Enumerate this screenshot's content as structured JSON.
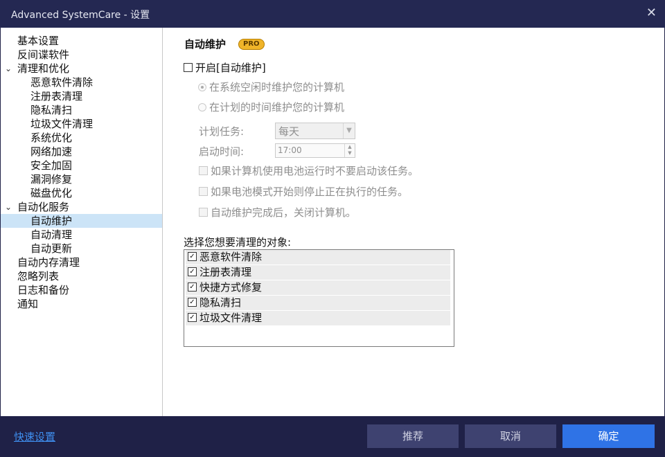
{
  "window": {
    "title": "Advanced SystemCare - 设置",
    "close_icon": "close-icon"
  },
  "sidebar": {
    "items": [
      {
        "label": "基本设置",
        "level": 0
      },
      {
        "label": "反间谍软件",
        "level": 0
      },
      {
        "label": "清理和优化",
        "level": 0,
        "expanded": true
      },
      {
        "label": "恶意软件清除",
        "level": 1
      },
      {
        "label": "注册表清理",
        "level": 1
      },
      {
        "label": "隐私清扫",
        "level": 1
      },
      {
        "label": "垃圾文件清理",
        "level": 1
      },
      {
        "label": "系统优化",
        "level": 1
      },
      {
        "label": "网络加速",
        "level": 1
      },
      {
        "label": "安全加固",
        "level": 1
      },
      {
        "label": "漏洞修复",
        "level": 1
      },
      {
        "label": "磁盘优化",
        "level": 1
      },
      {
        "label": "自动化服务",
        "level": 0,
        "expanded": true
      },
      {
        "label": "自动维护",
        "level": 1,
        "selected": true
      },
      {
        "label": "自动清理",
        "level": 1
      },
      {
        "label": "自动更新",
        "level": 1
      },
      {
        "label": "自动内存清理",
        "level": 0
      },
      {
        "label": "忽略列表",
        "level": 0
      },
      {
        "label": "日志和备份",
        "level": 0
      },
      {
        "label": "通知",
        "level": 0
      }
    ]
  },
  "main": {
    "section_title": "自动维护",
    "pro_badge": "PRO",
    "enable_label": "开启[自动维护]",
    "enable_checked": false,
    "radio_idle": "在系统空闲时维护您的计算机",
    "radio_schedule": "在计划的时间维护您的计算机",
    "schedule_label": "计划任务:",
    "schedule_value": "每天",
    "start_time_label": "启动时间:",
    "start_time_value": "17:00",
    "opt_battery": "如果计算机使用电池运行时不要启动该任务。",
    "opt_battery_stop": "如果电池模式开始则停止正在执行的任务。",
    "opt_shutdown": "自动维护完成后，关闭计算机。",
    "targets_label": "选择您想要清理的对象:",
    "targets": [
      {
        "label": "恶意软件清除",
        "checked": true
      },
      {
        "label": "注册表清理",
        "checked": true
      },
      {
        "label": "快捷方式修复",
        "checked": true
      },
      {
        "label": "隐私清扫",
        "checked": true
      },
      {
        "label": "垃圾文件清理",
        "checked": true
      }
    ]
  },
  "footer": {
    "quick_settings": "快速设置",
    "recommend": "推荐",
    "cancel": "取消",
    "ok": "确定"
  },
  "colors": {
    "titlebar": "#242852",
    "footer": "#1f2147",
    "accent": "#2f73e6",
    "selected_item": "#cce4f7",
    "pro_badge": "#f0b429"
  }
}
